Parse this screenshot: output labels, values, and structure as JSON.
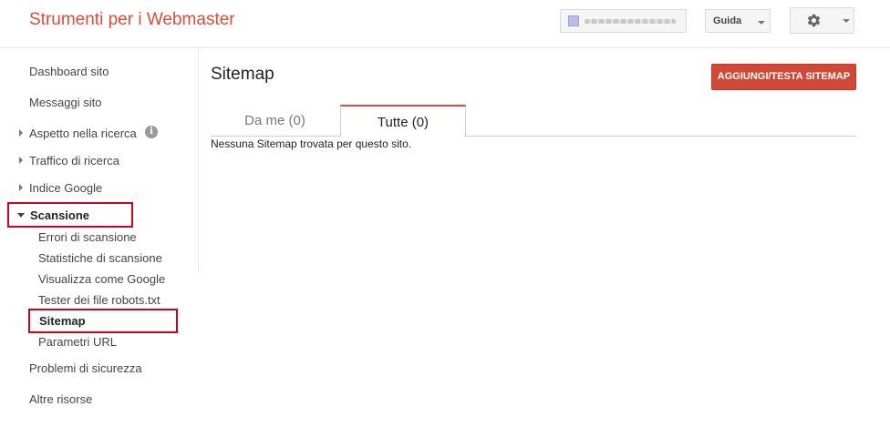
{
  "header": {
    "app_title": "Strumenti per i Webmaster",
    "help_label": "Guida"
  },
  "sidebar": {
    "dashboard": "Dashboard sito",
    "messages": "Messaggi sito",
    "search_appearance": "Aspetto nella ricerca",
    "search_traffic": "Traffico di ricerca",
    "google_index": "Indice Google",
    "crawl": "Scansione",
    "crawl_sub": {
      "crawl_errors": "Errori di scansione",
      "crawl_stats": "Statistiche di scansione",
      "fetch_as_google": "Visualizza come Google",
      "robots_tester": "Tester dei file robots.txt",
      "sitemaps": "Sitemap",
      "url_parameters": "Parametri URL"
    },
    "security_issues": "Problemi di sicurezza",
    "other_resources": "Altre risorse"
  },
  "main": {
    "page_title": "Sitemap",
    "add_button": "AGGIUNGI/TESTA SITEMAP",
    "tabs": [
      {
        "label": "Da me (0)",
        "active": false
      },
      {
        "label": "Tutte (0)",
        "active": true
      }
    ],
    "empty_message": "Nessuna Sitemap trovata per questo sito."
  },
  "colors": {
    "brand_red": "#dd4b39",
    "button_red": "#d14836",
    "highlight_box": "#d0021b"
  }
}
